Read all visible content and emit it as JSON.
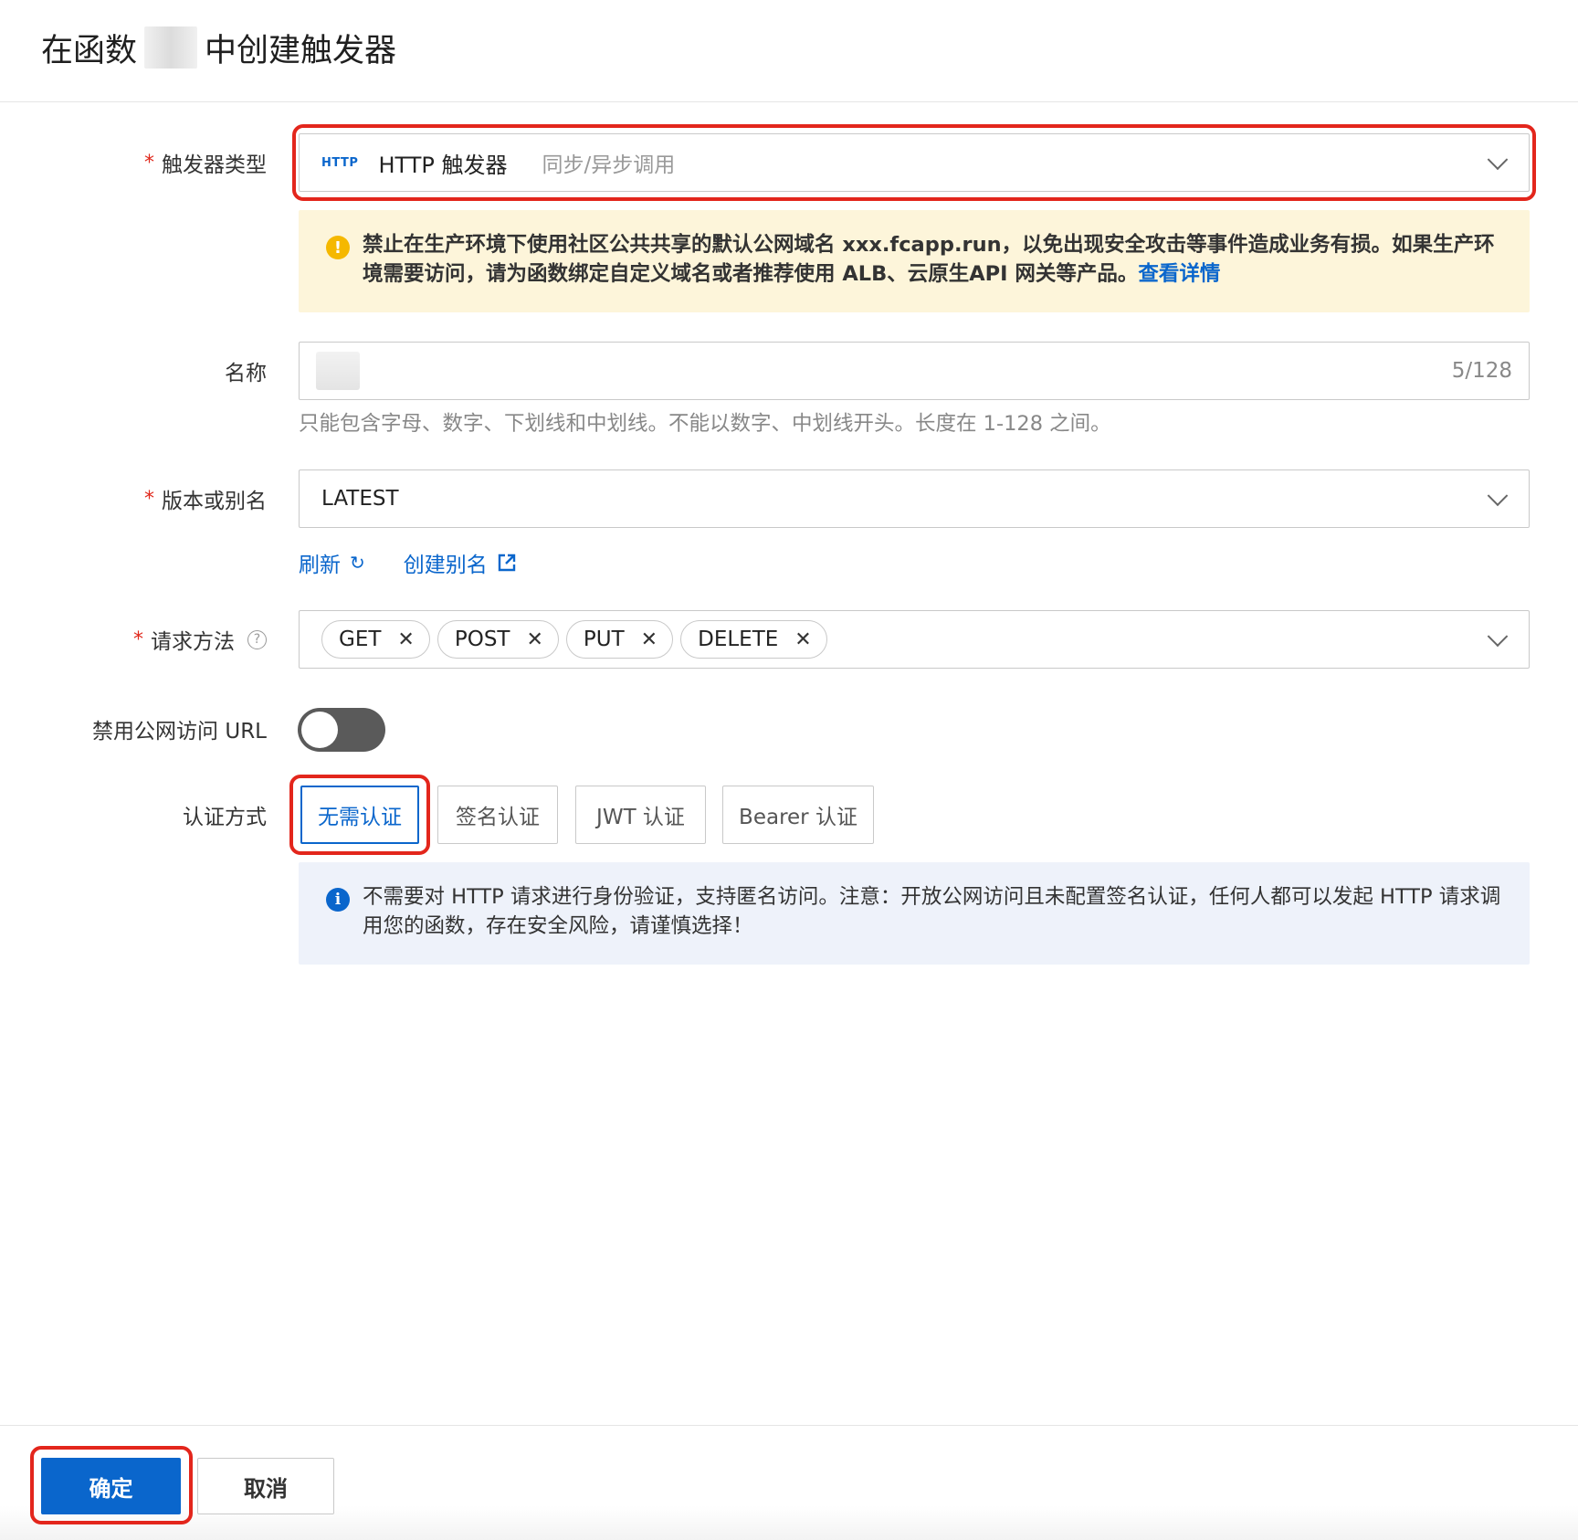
{
  "header": {
    "title_prefix": "在函数",
    "title_suffix": "中创建触发器"
  },
  "form": {
    "trigger_type": {
      "label": "触发器类型",
      "required_mark": "*",
      "badge": "HTTP",
      "value": "HTTP 触发器",
      "description": "同步/异步调用"
    },
    "warning": {
      "text": "禁止在生产环境下使用社区公共共享的默认公网域名 xxx.fcapp.run，以免出现安全攻击等事件造成业务有损。如果生产环境需要访问，请为函数绑定自定义域名或者推荐使用 ALB、云原生API 网关等产品。",
      "link": "查看详情"
    },
    "name": {
      "label": "名称",
      "counter": "5/128",
      "hint": "只能包含字母、数字、下划线和中划线。不能以数字、中划线开头。长度在 1-128 之间。"
    },
    "version": {
      "label": "版本或别名",
      "required_mark": "*",
      "value": "LATEST",
      "refresh": "刷新",
      "create_alias": "创建别名"
    },
    "methods": {
      "label": "请求方法",
      "required_mark": "*",
      "tags": [
        "GET",
        "POST",
        "PUT",
        "DELETE"
      ]
    },
    "disable_public_url": {
      "label": "禁用公网访问 URL",
      "enabled": false
    },
    "auth": {
      "label": "认证方式",
      "options": [
        "无需认证",
        "签名认证",
        "JWT 认证",
        "Bearer 认证"
      ],
      "selected": "无需认证",
      "info": "不需要对 HTTP 请求进行身份验证，支持匿名访问。注意：开放公网访问且未配置签名认证，任何人都可以发起 HTTP 请求调用您的函数，存在安全风险，请谨慎选择！"
    }
  },
  "footer": {
    "confirm": "确定",
    "cancel": "取消"
  },
  "colors": {
    "primary": "#0a66cc",
    "highlight_border": "#e3261c",
    "warning_bg": "#fdf5da",
    "info_bg": "#eef2fa"
  }
}
